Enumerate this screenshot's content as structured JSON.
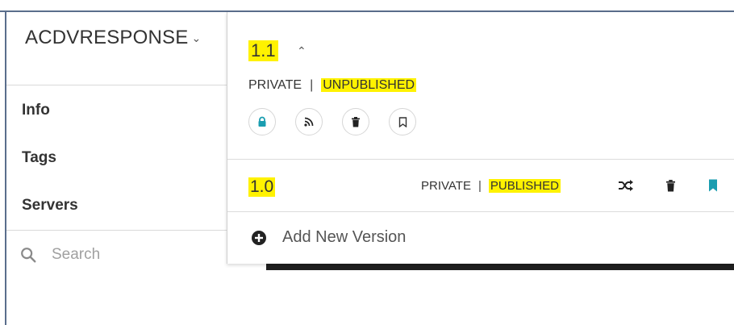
{
  "sidebar": {
    "api_title": "ACDVRESPONSE",
    "nav": [
      {
        "label": "Info"
      },
      {
        "label": "Tags"
      },
      {
        "label": "Servers"
      }
    ],
    "search_placeholder": "Search"
  },
  "versions_panel": {
    "current": {
      "version": "1.1",
      "visibility": "PRIVATE",
      "separator": "|",
      "state": "UNPUBLISHED",
      "actions": [
        "lock-icon",
        "rss-icon",
        "trash-icon",
        "bookmark-icon"
      ]
    },
    "rows": [
      {
        "version": "1.0",
        "visibility": "PRIVATE",
        "separator": "|",
        "state": "PUBLISHED",
        "actions": [
          "shuffle-icon",
          "trash-icon",
          "bookmark-icon"
        ]
      }
    ],
    "add_new_label": "Add New Version"
  },
  "colors": {
    "highlight": "#fff200",
    "accent_teal": "#1a9db0",
    "frame": "#5a6e8c"
  }
}
